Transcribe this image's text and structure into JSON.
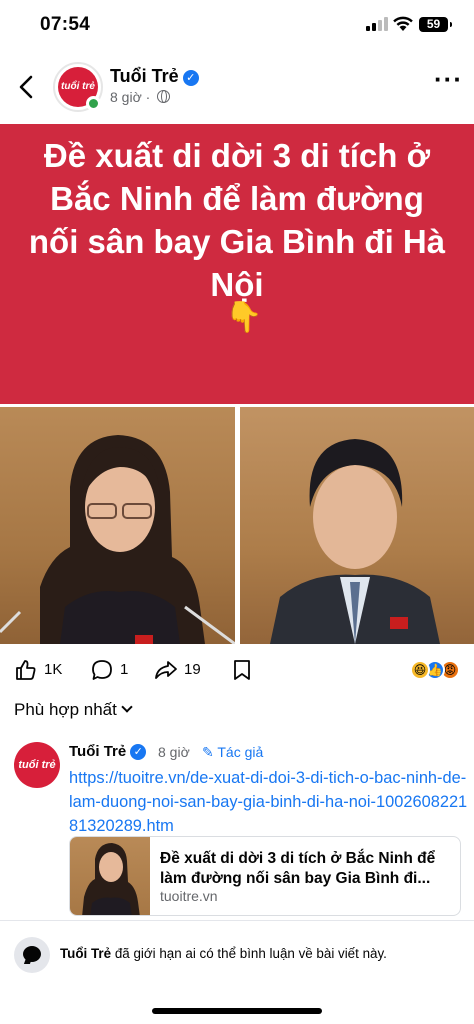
{
  "status_bar": {
    "time": "07:54",
    "battery": "59"
  },
  "post": {
    "page_name": "Tuổi Trẻ",
    "avatar_text": "tuổi trẻ",
    "time": "8 giờ",
    "banner_title": "Đề xuất di dời 3 di tích ở Bắc Ninh để làm đường nối sân bay Gia Bình đi Hà Nội",
    "banner_emoji": "👇"
  },
  "actions": {
    "likes": "1K",
    "comments": "1",
    "shares": "19"
  },
  "sort": {
    "label": "Phù hợp nhất"
  },
  "comment": {
    "author": "Tuổi Trẻ",
    "avatar_text": "tuổi trẻ",
    "time": "8 giờ",
    "author_badge": "Tác giả",
    "link": "https://tuoitre.vn/de-xuat-di-doi-3-di-tich-o-bac-ninh-de-lam-duong-noi-san-bay-gia-binh-di-ha-noi-100260822181320289.htm",
    "preview_title": "Đề xuất di dời 3 di tích ở Bắc Ninh để làm đường nối sân bay Gia Bình đi...",
    "preview_domain": "tuoitre.vn"
  },
  "notice": {
    "page": "Tuổi Trẻ",
    "text": "đã giới hạn ai có thể bình luận về bài viết này."
  },
  "colors": {
    "banner": "#cf2a40",
    "link": "#1877f2",
    "brand": "#d71f3a"
  }
}
